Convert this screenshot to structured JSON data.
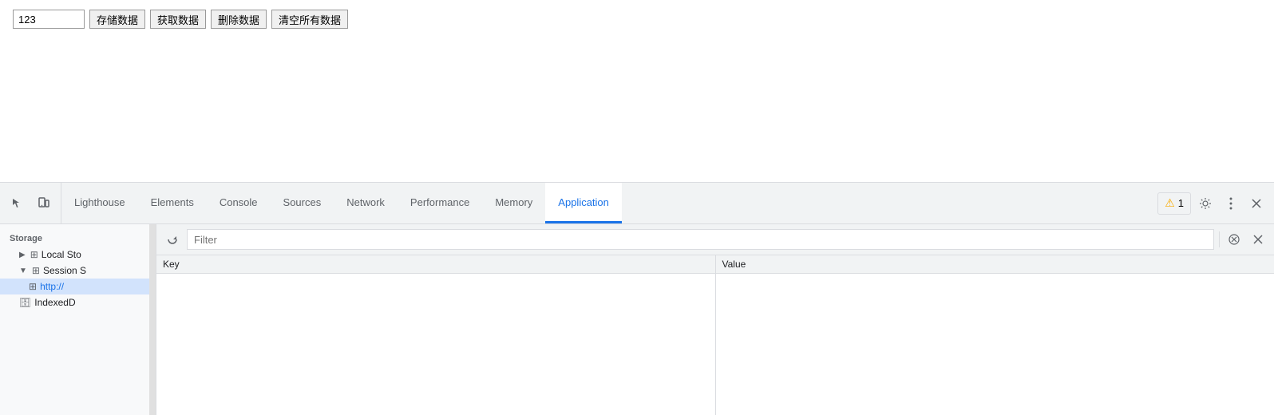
{
  "page": {
    "input_value": "123",
    "buttons": [
      {
        "label": "存储数据",
        "name": "save-button"
      },
      {
        "label": "获取数据",
        "name": "get-button"
      },
      {
        "label": "删除数据",
        "name": "delete-button"
      },
      {
        "label": "清空所有数据",
        "name": "clear-button"
      }
    ]
  },
  "devtools": {
    "tabs": [
      {
        "label": "Lighthouse",
        "name": "tab-lighthouse",
        "active": false
      },
      {
        "label": "Elements",
        "name": "tab-elements",
        "active": false
      },
      {
        "label": "Console",
        "name": "tab-console",
        "active": false
      },
      {
        "label": "Sources",
        "name": "tab-sources",
        "active": false
      },
      {
        "label": "Network",
        "name": "tab-network",
        "active": false
      },
      {
        "label": "Performance",
        "name": "tab-performance",
        "active": false
      },
      {
        "label": "Memory",
        "name": "tab-memory",
        "active": false
      },
      {
        "label": "Application",
        "name": "tab-application",
        "active": true
      }
    ],
    "warning_count": "1",
    "icons": {
      "inspect": "⬡",
      "device": "⬒",
      "gear": "⚙",
      "more": "⋮",
      "close": "✕"
    }
  },
  "sidebar": {
    "storage_label": "Storage",
    "items": [
      {
        "label": "Local Sto",
        "icon": "grid",
        "indent": 1,
        "arrow": "▶",
        "name": "local-storage"
      },
      {
        "label": "Session S",
        "icon": "grid",
        "indent": 1,
        "arrow": "▼",
        "name": "session-storage"
      },
      {
        "label": "http://",
        "icon": "grid",
        "indent": 2,
        "active": true,
        "name": "session-storage-url"
      },
      {
        "label": "IndexedD",
        "icon": "db",
        "indent": 1,
        "name": "indexeddb"
      }
    ]
  },
  "filter": {
    "placeholder": "Filter",
    "value": ""
  },
  "table": {
    "col_key": "Key",
    "col_value": "Value"
  }
}
